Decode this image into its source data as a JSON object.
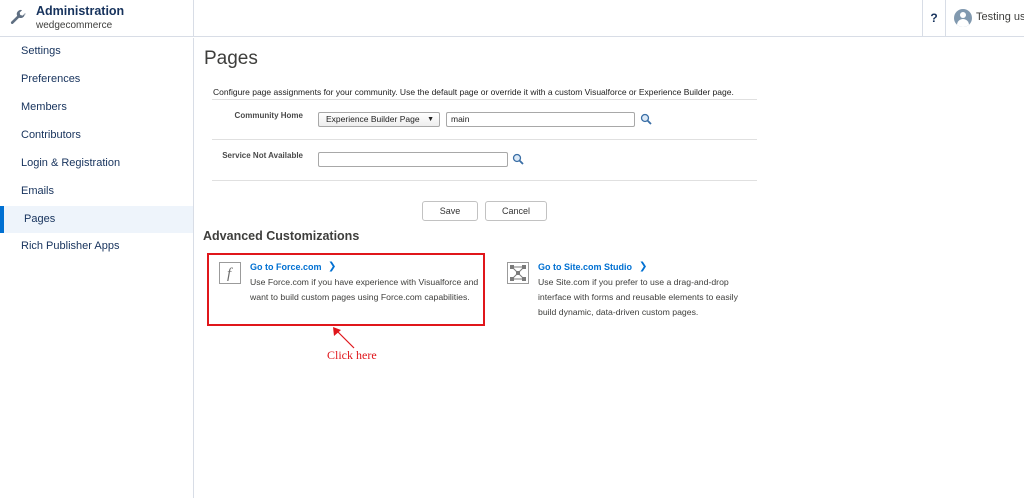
{
  "header": {
    "app_title": "Administration",
    "app_subtitle": "wedgecommerce",
    "help_label": "?",
    "user_name": "Testing use"
  },
  "sidebar": {
    "items": [
      {
        "label": "Settings"
      },
      {
        "label": "Preferences"
      },
      {
        "label": "Members"
      },
      {
        "label": "Contributors"
      },
      {
        "label": "Login & Registration"
      },
      {
        "label": "Emails"
      },
      {
        "label": "Pages",
        "active": true
      },
      {
        "label": "Rich Publisher Apps"
      }
    ]
  },
  "main": {
    "title": "Pages",
    "intro": "Configure page assignments for your community. Use the default page or override it with a custom Visualforce or Experience Builder page.",
    "community_home": {
      "label": "Community Home",
      "type_value": "Experience Builder Page",
      "page_value": "main"
    },
    "service_not_available": {
      "label": "Service Not Available",
      "page_value": ""
    },
    "save_label": "Save",
    "cancel_label": "Cancel",
    "advanced_title": "Advanced Customizations",
    "force_card": {
      "link": "Go to Force.com",
      "desc": "Use Force.com if you have experience with Visualforce and want to build custom pages using Force.com capabilities."
    },
    "site_card": {
      "link": "Go to Site.com Studio",
      "desc": "Use Site.com if you prefer to use a drag-and-drop interface with forms and reusable elements to easily build dynamic, data-driven custom pages."
    }
  },
  "annotation": {
    "text": "Click here"
  },
  "colors": {
    "accent": "#0070d2",
    "annotation_red": "#e0161b",
    "active_nav_bg": "#eef4fb"
  }
}
